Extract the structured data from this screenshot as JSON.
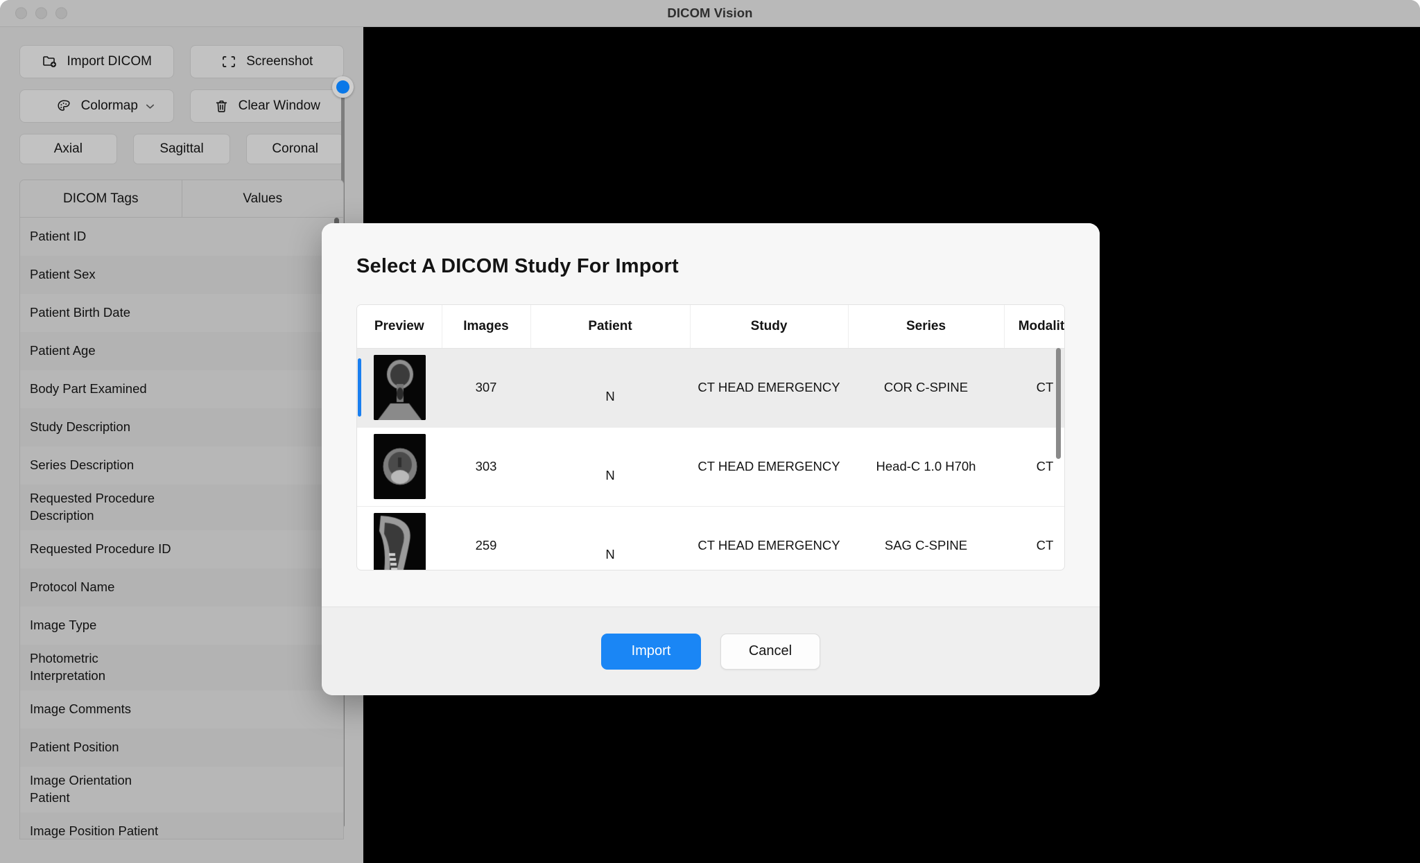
{
  "window": {
    "title": "DICOM Vision",
    "traffic_lights": [
      "close-button",
      "minimize-button",
      "zoom-button"
    ]
  },
  "toolbar": {
    "import_dicom_label": "Import DICOM",
    "screenshot_label": "Screenshot",
    "colormap_label": "Colormap",
    "clear_window_label": "Clear Window",
    "views": [
      "Axial",
      "Sagittal",
      "Coronal"
    ],
    "slider": {
      "value_position": "top",
      "knob_color": "#0a78e8"
    }
  },
  "tag_panel": {
    "columns": [
      "DICOM Tags",
      "Values"
    ],
    "tags": [
      "Patient ID",
      "Patient Sex",
      "Patient Birth Date",
      "Patient Age",
      "Body Part Examined",
      "Study Description",
      "Series Description",
      "Requested Procedure\nDescription",
      "Requested Procedure ID",
      "Protocol Name",
      "Image Type",
      "Photometric\nInterpretation",
      "Image Comments",
      "Patient Position",
      "Image Orientation\nPatient",
      "Image Position Patient"
    ],
    "values": [
      "",
      "",
      "",
      "",
      "",
      "",
      "",
      "",
      "",
      "",
      "",
      "",
      "",
      "",
      "",
      ""
    ]
  },
  "modal": {
    "title": "Select A DICOM Study For Import",
    "columns": [
      "Preview",
      "Images",
      "Patient",
      "Study",
      "Series",
      "Modality"
    ],
    "rows": [
      {
        "preview": "ct-coronal-neck-thumbnail",
        "images": "307",
        "patient": "N",
        "study": "CT  HEAD EMERGENCY",
        "series": "COR C-SPINE",
        "modality": "CT",
        "selected": true
      },
      {
        "preview": "ct-axial-head-thumbnail",
        "images": "303",
        "patient": "N",
        "study": "CT  HEAD EMERGENCY",
        "series": "Head-C  1.0  H70h",
        "modality": "CT",
        "selected": false
      },
      {
        "preview": "ct-sagittal-spine-thumbnail",
        "images": "259",
        "patient": "N",
        "study": "CT  HEAD EMERGENCY",
        "series": "SAG C-SPINE",
        "modality": "CT",
        "selected": false
      }
    ],
    "import_label": "Import",
    "cancel_label": "Cancel"
  },
  "colors": {
    "accent_blue": "#1a86f5",
    "selection_blue": "#1a7ff0",
    "window_chrome": "#b6b6b6",
    "viewer_background": "#000000",
    "modal_background": "#f7f7f7"
  }
}
